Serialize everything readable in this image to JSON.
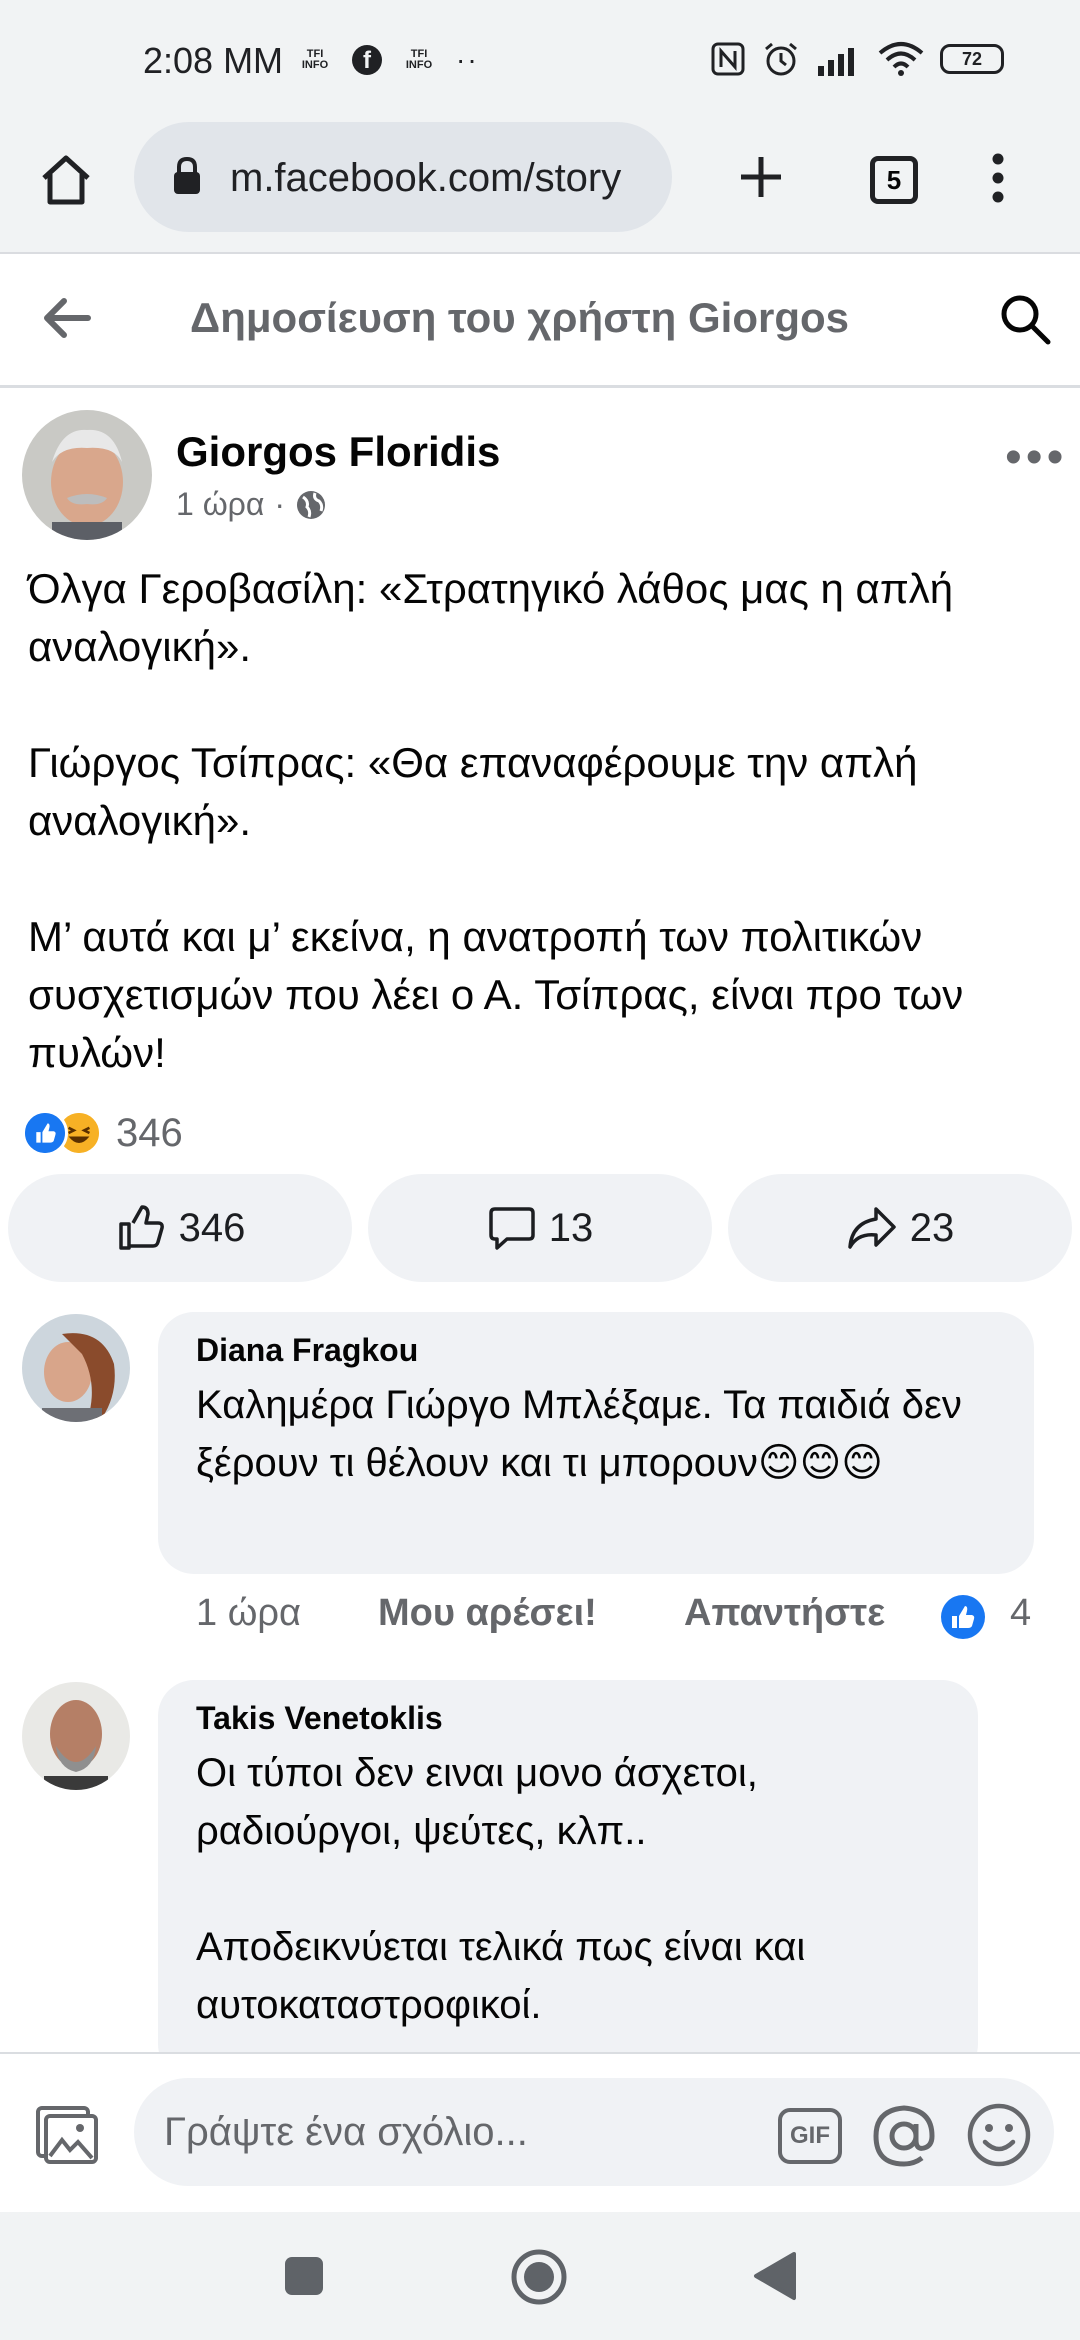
{
  "status_bar": {
    "time": "2:08 MM",
    "info_icon_text": "TFI INFO",
    "overflow_dots": "··",
    "battery": "72",
    "icons": [
      "nfc-icon",
      "alarm-icon",
      "signal-icon",
      "wifi-icon",
      "battery-icon"
    ]
  },
  "browser": {
    "url": "m.facebook.com/story",
    "tab_count": "5",
    "icons": [
      "home-icon",
      "lock-icon",
      "new-tab-icon",
      "tabs-icon",
      "menu-icon"
    ]
  },
  "header": {
    "title": "Δημοσίευση του χρήστη Giorgos"
  },
  "post": {
    "author": "Giorgos Floridis",
    "time": "1 ώρα",
    "separator": "·",
    "paragraphs": [
      "Όλγα Γεροβασίλη: «Στρατηγικό λάθος μας η απλή αναλογική».",
      "Γιώργος Τσίπρας: «Θα επαναφέρουμε την απλή αναλογική».",
      "Μ’ αυτά και μ’ εκείνα, η ανατροπή των πολιτικών συσχετισμών που λέει ο Α. Τσίπρας, είναι προ των πυλών!"
    ],
    "reactions_count": "346",
    "actions": {
      "like_count": "346",
      "comment_count": "13",
      "share_count": "23"
    }
  },
  "comments": [
    {
      "author": "Diana Fragkou",
      "text": "Καλημέρα Γιώργο Μπλέξαμε. Τα παιδιά δεν ξέρουν τι θέλουν και τι μπορουν😊😊😊",
      "time": "1 ώρα",
      "like_label": "Μου αρέσει!",
      "reply_label": "Απαντήστε",
      "likes": "4"
    },
    {
      "author": "Takis Venetoklis",
      "text_lines": [
        "Οι τύποι δεν ειναι μονο άσχετοι, ραδιούργοι, ψεύτες, κλπ..",
        "Αποδεικνύεται τελικά πως είναι  και αυτοκαταστροφικοί."
      ]
    }
  ],
  "composer": {
    "placeholder": "Γράψτε ένα σχόλιο...",
    "gif_label": "GIF",
    "mention_label": "@"
  },
  "colors": {
    "facebook_blue": "#1877f2",
    "secondary_text": "#65676b",
    "bubble_bg": "#f0f2f5",
    "chrome_bg": "#f1f3f4"
  }
}
